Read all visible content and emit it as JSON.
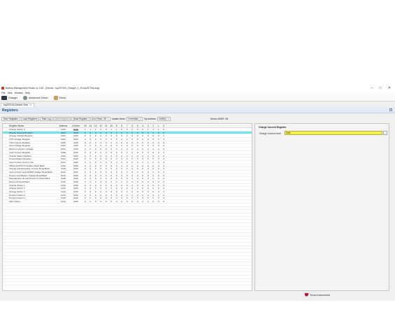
{
  "window": {
    "title": "Battery Management Studio v1.3.80 - [Device : bq25703A_Charger_1_00-bq25703A.bqz]",
    "controls": [
      "–",
      "□",
      "✕"
    ]
  },
  "menu": [
    "File",
    "View",
    "Window",
    "Help"
  ],
  "ribbon": {
    "charger": "Charger",
    "advanced_comm": "Advanced Comm",
    "errors": "Errors"
  },
  "tab": {
    "label": "bq25703A Default View",
    "close": "✕"
  },
  "panel": {
    "title": "Registers",
    "collapse": "^"
  },
  "toolbar": {
    "save": "Save Registers",
    "load": "Load Registers",
    "start_log": "Start Log",
    "write_register": "Write Register",
    "read_register": "Read Register",
    "auto_read": "Auto Read: Off",
    "update_mode_label": "Update Mode:",
    "update_mode": "Immediate",
    "tgt_address_label": "Tgt Address:",
    "tgt_address": "0x6B(h)",
    "device_addr": "Device ADDR: D6"
  },
  "table": {
    "headers": [
      "Register Name",
      "Address",
      "Current Value",
      "15",
      "14",
      "13",
      "12",
      "11",
      "10",
      "9",
      "8",
      "7",
      "6",
      "5",
      "4",
      "3",
      "2",
      "1",
      "0"
    ],
    "rows": [
      [
        "Charge Option 0",
        "0x00",
        "0x0E",
        "1",
        "1",
        "1",
        "0",
        "0",
        "1",
        "1",
        "0",
        "0",
        "0",
        "0",
        "0",
        "1",
        "1",
        "1",
        "0"
      ],
      [
        "Charge Current Register",
        "0x02",
        "0x00",
        "0",
        "0",
        "0",
        "0",
        "0",
        "0",
        "0",
        "0",
        "0",
        "0",
        "0",
        "0",
        "0",
        "0",
        "0",
        "0"
      ],
      [
        "Charge Voltage Register",
        "0x04",
        "0x00",
        "0",
        "0",
        "0",
        "0",
        "0",
        "0",
        "0",
        "0",
        "0",
        "0",
        "0",
        "0",
        "0",
        "0",
        "0",
        "0"
      ],
      [
        "OTG Voltage Register",
        "0x06",
        "0x00",
        "0",
        "0",
        "0",
        "0",
        "0",
        "0",
        "0",
        "0",
        "0",
        "0",
        "0",
        "0",
        "0",
        "0",
        "0",
        "0"
      ],
      [
        "OTG Current Register",
        "0x08",
        "0x00",
        "0",
        "0",
        "0",
        "0",
        "0",
        "0",
        "0",
        "0",
        "0",
        "0",
        "0",
        "0",
        "0",
        "0",
        "0",
        "0"
      ],
      [
        "Input Voltage Register",
        "0x0A",
        "0x00",
        "0",
        "0",
        "0",
        "0",
        "0",
        "0",
        "0",
        "0",
        "0",
        "0",
        "0",
        "0",
        "0",
        "0",
        "0",
        "0"
      ],
      [
        "Minimum System Voltage",
        "0x0C",
        "0x00",
        "0",
        "0",
        "0",
        "0",
        "0",
        "0",
        "0",
        "0",
        "0",
        "0",
        "0",
        "0",
        "0",
        "0",
        "0",
        "0"
      ],
      [
        "Input Current Register",
        "0x0E",
        "0x00",
        "0",
        "0",
        "0",
        "0",
        "0",
        "0",
        "0",
        "0",
        "0",
        "0",
        "0",
        "0",
        "0",
        "0",
        "0",
        "0"
      ],
      [
        "Charge Status Register",
        "0x20",
        "0x00",
        "0",
        "0",
        "0",
        "0",
        "0",
        "0",
        "0",
        "0",
        "0",
        "0",
        "0",
        "0",
        "0",
        "0",
        "0",
        "0"
      ],
      [
        "ProchotStatus Register",
        "0x22",
        "0x00",
        "0",
        "0",
        "0",
        "0",
        "0",
        "0",
        "0",
        "0",
        "0",
        "0",
        "0",
        "0",
        "0",
        "0",
        "0",
        "0"
      ],
      [
        "Input Current Limit in Use",
        "0x24",
        "0x00",
        "0",
        "0",
        "0",
        "0",
        "0",
        "0",
        "0",
        "0",
        "0",
        "0",
        "0",
        "0",
        "0",
        "0",
        "0",
        "0"
      ],
      [
        "VBUS and PSYS Voltage Read Back",
        "0x26",
        "0x00",
        "0",
        "0",
        "0",
        "0",
        "0",
        "0",
        "0",
        "0",
        "0",
        "0",
        "0",
        "0",
        "0",
        "0",
        "0",
        "0"
      ],
      [
        "Charge and Discharge Current Read Back",
        "0x28",
        "0x00",
        "0",
        "0",
        "0",
        "0",
        "0",
        "0",
        "0",
        "0",
        "0",
        "0",
        "0",
        "0",
        "0",
        "0",
        "0",
        "0"
      ],
      [
        "Input Current and CMPIN Voltage Read Back",
        "0x2A",
        "0x00",
        "0",
        "0",
        "0",
        "0",
        "0",
        "0",
        "0",
        "0",
        "0",
        "0",
        "0",
        "0",
        "0",
        "0",
        "0",
        "0"
      ],
      [
        "System and Battery Voltage Read Back",
        "0x2C",
        "0x00",
        "0",
        "0",
        "0",
        "0",
        "0",
        "0",
        "0",
        "0",
        "0",
        "0",
        "0",
        "0",
        "0",
        "0",
        "0",
        "0"
      ],
      [
        "Manufacturer ID and Device ID Read Back",
        "0x2E",
        "0x00",
        "0",
        "0",
        "0",
        "0",
        "0",
        "0",
        "0",
        "0",
        "0",
        "0",
        "0",
        "0",
        "0",
        "0",
        "0",
        "0"
      ],
      [
        "Device ID Read Back",
        "0x2F",
        "0x00",
        "0",
        "0",
        "0",
        "0",
        "0",
        "0",
        "0",
        "0",
        "0",
        "0",
        "0",
        "0",
        "0",
        "0",
        "0",
        "0"
      ],
      [
        "Charge Option 1",
        "0x30",
        "0x00",
        "0",
        "0",
        "0",
        "0",
        "0",
        "0",
        "0",
        "0",
        "0",
        "0",
        "0",
        "0",
        "0",
        "0",
        "0",
        "0"
      ],
      [
        "Charge Option 2",
        "0x32",
        "0x00",
        "0",
        "0",
        "0",
        "0",
        "0",
        "0",
        "0",
        "0",
        "0",
        "0",
        "0",
        "0",
        "0",
        "0",
        "0",
        "0"
      ],
      [
        "Charge Option 3",
        "0x34",
        "0x00",
        "0",
        "0",
        "0",
        "0",
        "0",
        "0",
        "0",
        "0",
        "0",
        "0",
        "0",
        "0",
        "0",
        "0",
        "0",
        "0"
      ],
      [
        "Prochot Option 0",
        "0x36",
        "0x00",
        "0",
        "0",
        "0",
        "0",
        "0",
        "0",
        "0",
        "0",
        "0",
        "0",
        "0",
        "0",
        "0",
        "0",
        "0",
        "0"
      ],
      [
        "Prochot Option 1",
        "0x38",
        "0x00",
        "0",
        "0",
        "0",
        "0",
        "0",
        "0",
        "0",
        "0",
        "0",
        "0",
        "0",
        "0",
        "0",
        "0",
        "0",
        "0"
      ],
      [
        "ADC Option",
        "0x3A",
        "0x00",
        "0",
        "0",
        "0",
        "0",
        "0",
        "0",
        "0",
        "0",
        "0",
        "0",
        "0",
        "0",
        "0",
        "0",
        "0",
        "0"
      ]
    ],
    "selected_index": 1
  },
  "detail": {
    "title": "Charge Current Register",
    "field_label": "Charge Current Limit",
    "field_value": "0mA",
    "field_button": "..."
  },
  "footer": {
    "brand": "Texas Instruments",
    "grip": "::"
  },
  "colors": {
    "selected_row": "#6fe3ee",
    "field_highlight": "#f6f04c",
    "panel_header": "#e3ecf6",
    "ti_red": "#c8102e"
  }
}
